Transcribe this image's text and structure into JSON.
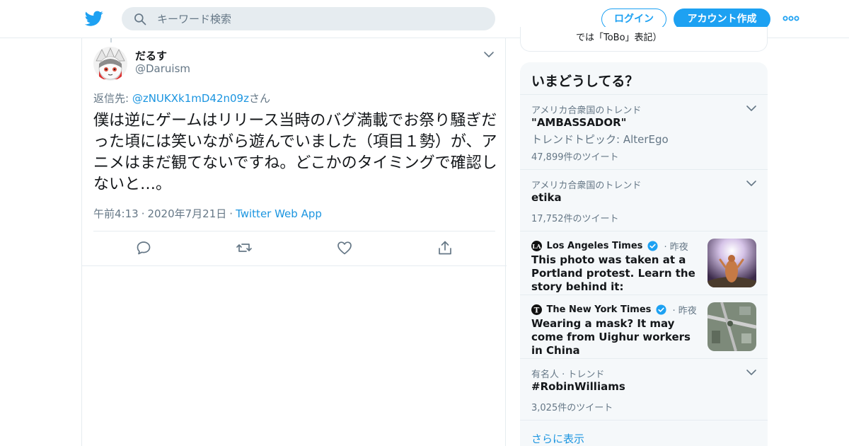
{
  "header": {
    "search_placeholder": "キーワード検索",
    "login_label": "ログイン",
    "signup_label": "アカウント作成",
    "brand_color": "#1da1f2"
  },
  "tweet": {
    "display_name": "だるす",
    "handle": "@Daruism",
    "reply_prefix": "返信先: ",
    "reply_handle": "@zNUKXk1mD42n09z",
    "reply_suffix": "さん",
    "text": "僕は逆にゲームはリリース当時のバグ満載でお祭り騒ぎだった頃には笑いながら遊んでいました（項目１勢）が、アニメはまだ観てないですね。どこかのタイミングで確認しないと…。",
    "time": "午前4:13",
    "date": "2020年7月21日",
    "source": "Twitter Web App",
    "separator": "·"
  },
  "sidebar": {
    "prev_card_text": "では「ToBo」表記）",
    "trends_title": "いまどうしてる？",
    "trends": [
      {
        "meta": "アメリカ合衆国のトレンド",
        "name": "\"AMBASSADOR\"",
        "sub": "トレンドトピック: AlterEgo",
        "count": "47,899件のツイート"
      },
      {
        "meta": "アメリカ合衆国のトレンド",
        "name": "etika",
        "count": "17,752件のツイート"
      }
    ],
    "news": [
      {
        "source": "Los Angeles Times",
        "time": "· 昨夜",
        "headline": "This photo was taken at a Portland protest. Learn the story behind it:"
      },
      {
        "source": "The New York Times",
        "time": "· 昨夜",
        "headline": "Wearing a mask? It may come from Uighur workers in China"
      }
    ],
    "trend3": {
      "meta": "有名人 · トレンド",
      "name": "#RobinWilliams",
      "count": "3,025件のツイート"
    },
    "show_more": "さらに表示"
  }
}
